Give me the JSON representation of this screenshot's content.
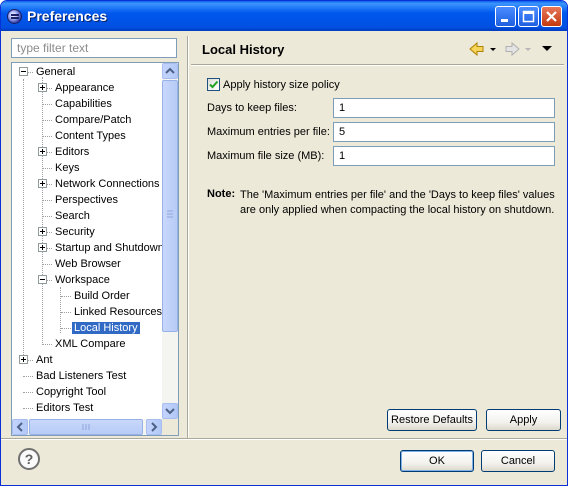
{
  "window": {
    "title": "Preferences"
  },
  "filter": {
    "placeholder": "type filter text"
  },
  "tree": {
    "items": [
      {
        "label": "General",
        "expander": "minus"
      },
      {
        "label": "Appearance",
        "expander": "plus"
      },
      {
        "label": "Capabilities"
      },
      {
        "label": "Compare/Patch"
      },
      {
        "label": "Content Types"
      },
      {
        "label": "Editors",
        "expander": "plus"
      },
      {
        "label": "Keys"
      },
      {
        "label": "Network Connections",
        "expander": "plus"
      },
      {
        "label": "Perspectives"
      },
      {
        "label": "Search"
      },
      {
        "label": "Security",
        "expander": "plus"
      },
      {
        "label": "Startup and Shutdown",
        "expander": "plus"
      },
      {
        "label": "Web Browser"
      },
      {
        "label": "Workspace",
        "expander": "minus"
      },
      {
        "label": "Build Order"
      },
      {
        "label": "Linked Resources"
      },
      {
        "label": "Local History",
        "selected": true
      },
      {
        "label": "XML Compare"
      },
      {
        "label": "Ant",
        "expander": "plus"
      },
      {
        "label": "Bad Listeners Test"
      },
      {
        "label": "Copyright Tool"
      },
      {
        "label": "Editors Test"
      }
    ]
  },
  "page": {
    "title": "Local History",
    "apply_policy": {
      "label": "Apply history size policy",
      "checked": true
    },
    "fields": [
      {
        "label": "Days to keep files:",
        "value": "1"
      },
      {
        "label": "Maximum entries per file:",
        "value": "5"
      },
      {
        "label": "Maximum file size (MB):",
        "value": "1"
      }
    ],
    "note_label": "Note:",
    "note_text": "The 'Maximum entries per file' and the 'Days to keep files' values are only applied when compacting the local history on shutdown.",
    "restore_defaults": "Restore Defaults",
    "apply": "Apply"
  },
  "footer": {
    "help": "?",
    "ok": "OK",
    "cancel": "Cancel"
  },
  "colors": {
    "titlebar": "#0058ee",
    "selection": "#316ac5",
    "nav_arrow": "#d8a200",
    "check": "#21a121"
  },
  "icons": {
    "back": "arrow-left-icon",
    "forward": "arrow-right-icon",
    "menu": "triangle-down-icon",
    "help": "question-mark-icon"
  }
}
